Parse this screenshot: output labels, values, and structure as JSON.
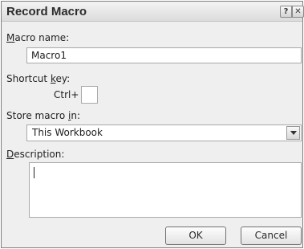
{
  "window": {
    "title": "Record Macro",
    "help_glyph": "?",
    "close_glyph": "✕"
  },
  "macro_name": {
    "label_prefix": "",
    "label_access_key": "M",
    "label_rest": "acro name:",
    "value": "Macro1"
  },
  "shortcut": {
    "label_prefix": "Shortcut ",
    "label_access_key": "k",
    "label_rest": "ey:",
    "ctrl_label": "Ctrl+",
    "value": ""
  },
  "store": {
    "label_prefix": "Store macro ",
    "label_access_key": "i",
    "label_rest": "n:",
    "selected": "This Workbook"
  },
  "description": {
    "label_prefix": "",
    "label_access_key": "D",
    "label_rest": "escription:",
    "value": ""
  },
  "buttons": {
    "ok": "OK",
    "cancel": "Cancel"
  }
}
